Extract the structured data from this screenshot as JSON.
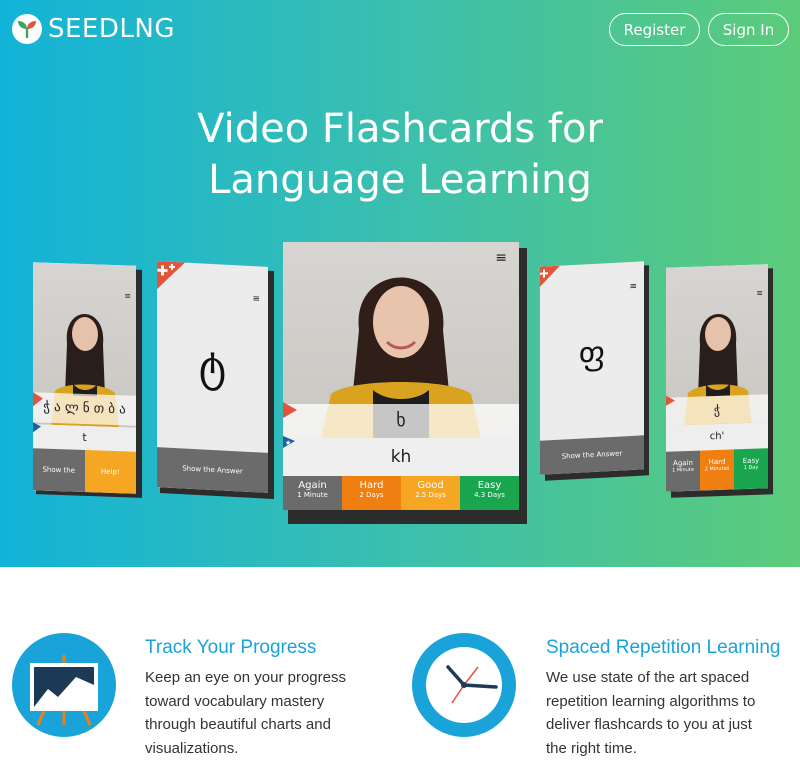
{
  "brand": {
    "name": "SEEDLNG"
  },
  "nav": {
    "register": "Register",
    "signin": "Sign In"
  },
  "hero": {
    "line1": "Video Flashcards for",
    "line2": "Language Learning"
  },
  "center_card": {
    "glyph": "ხ",
    "translit": "kh",
    "buttons": [
      {
        "label": "Again",
        "sub": "1 Minute",
        "color": "#6b6b6b"
      },
      {
        "label": "Hard",
        "sub": "2 Days",
        "color": "#f39a12"
      },
      {
        "label": "Good",
        "sub": "2.5 Days",
        "color": "#f5a623"
      },
      {
        "label": "Easy",
        "sub": "4.3 Days",
        "color": "#1aa54f"
      }
    ]
  },
  "left_far_card": {
    "word": "ჭ ა ლ ნ თ ბ ა",
    "translit": "t",
    "btn_show": "Show the Answer",
    "btn_help": "Help!"
  },
  "left_near_card": {
    "glyph": "ტ",
    "btn_show": "Show the Answer"
  },
  "right_near_card": {
    "glyph": "ფ",
    "btn_show": "Show the Answer"
  },
  "right_far_card": {
    "glyph": "ჭ",
    "translit": "ch'",
    "buttons": [
      {
        "label": "Again",
        "sub": "1 Minute"
      },
      {
        "label": "Hard",
        "sub": "2 Minutes"
      },
      {
        "label": "Easy",
        "sub": "1 Day"
      }
    ]
  },
  "features": [
    {
      "title": "Track Your Progress",
      "text": [
        "Keep an eye on your progress",
        "toward vocabulary mastery",
        "through beautiful charts and",
        "visualizations."
      ]
    },
    {
      "title": "Spaced Repetition Learning",
      "text": [
        "We use state of the art spaced",
        "repetition learning algorithms to",
        "deliver flashcards to you at just",
        "the right time."
      ]
    }
  ],
  "colors": {
    "accent": "#1aa3d9",
    "hero_start": "#12b3d8",
    "hero_end": "#5ccb7a",
    "hard": "#f39a12",
    "easy": "#1aa54f"
  }
}
